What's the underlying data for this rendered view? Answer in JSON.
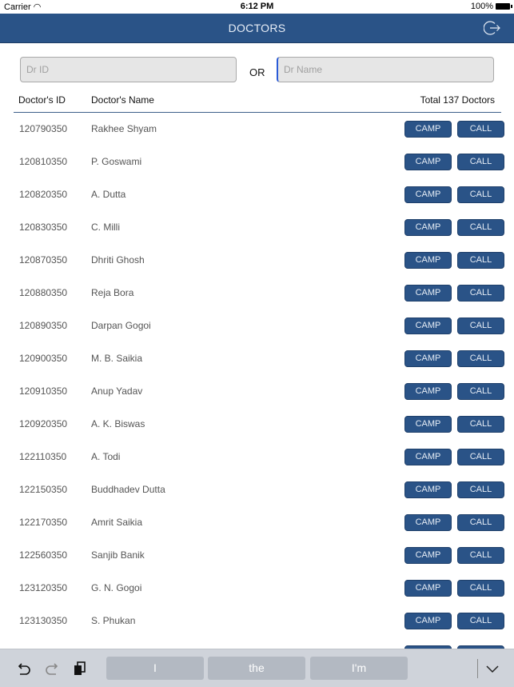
{
  "status_bar": {
    "carrier": "Carrier",
    "time": "6:12 PM",
    "battery": "100%"
  },
  "navbar": {
    "title": "DOCTORS",
    "logout_icon": "logout-arrow-icon"
  },
  "search": {
    "id_placeholder": "Dr ID",
    "id_value": "",
    "or_label": "OR",
    "name_placeholder": "Dr Name",
    "name_value": ""
  },
  "table": {
    "col_id": "Doctor's ID",
    "col_name": "Doctor's Name",
    "total": "Total 137 Doctors",
    "camp_label": "CAMP",
    "call_label": "CALL",
    "rows": [
      {
        "id": "120790350",
        "name": "Rakhee Shyam"
      },
      {
        "id": "120810350",
        "name": "P. Goswami"
      },
      {
        "id": "120820350",
        "name": "A. Dutta"
      },
      {
        "id": "120830350",
        "name": "C. Milli"
      },
      {
        "id": "120870350",
        "name": "Dhriti Ghosh"
      },
      {
        "id": "120880350",
        "name": "Reja Bora"
      },
      {
        "id": "120890350",
        "name": "Darpan Gogoi"
      },
      {
        "id": "120900350",
        "name": "M. B. Saikia"
      },
      {
        "id": "120910350",
        "name": "Anup Yadav"
      },
      {
        "id": "120920350",
        "name": "A. K. Biswas"
      },
      {
        "id": "122110350",
        "name": "A. Todi"
      },
      {
        "id": "122150350",
        "name": "Buddhadev Dutta"
      },
      {
        "id": "122170350",
        "name": "Amrit Saikia"
      },
      {
        "id": "122560350",
        "name": "Sanjib Banik"
      },
      {
        "id": "123120350",
        "name": "G. N. Gogoi"
      },
      {
        "id": "123130350",
        "name": "S. Phukan"
      },
      {
        "id": "",
        "name": ""
      }
    ]
  },
  "keyboard_bar": {
    "suggestions": [
      "I",
      "the",
      "I'm"
    ]
  },
  "colors": {
    "brand": "#2a5387"
  }
}
